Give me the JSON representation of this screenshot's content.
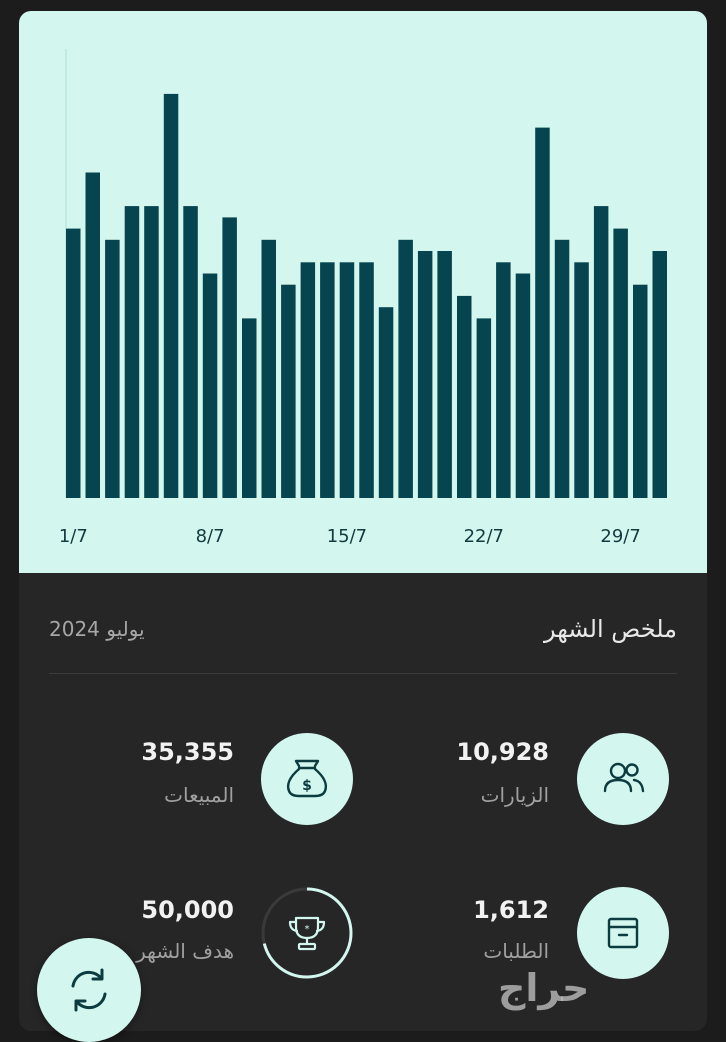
{
  "chart_data": {
    "type": "bar",
    "categories": [
      "1/7",
      "2/7",
      "3/7",
      "4/7",
      "5/7",
      "6/7",
      "7/7",
      "8/7",
      "9/7",
      "10/7",
      "11/7",
      "12/7",
      "13/7",
      "14/7",
      "15/7",
      "16/7",
      "17/7",
      "18/7",
      "19/7",
      "20/7",
      "21/7",
      "22/7",
      "23/7",
      "24/7",
      "25/7",
      "26/7",
      "27/7",
      "28/7",
      "29/7",
      "30/7",
      "31/7"
    ],
    "values": [
      24,
      29,
      23,
      26,
      26,
      36,
      26,
      20,
      25,
      16,
      23,
      19,
      21,
      21,
      21,
      21,
      17,
      23,
      22,
      22,
      18,
      16,
      21,
      20,
      33,
      23,
      21,
      26,
      24,
      19,
      22
    ],
    "x_tick_labels": [
      "1/7",
      "8/7",
      "15/7",
      "22/7",
      "29/7"
    ],
    "ylim": [
      0,
      40
    ],
    "grid": false,
    "bar_color": "#06454f",
    "background": "#d3f7ef"
  },
  "summary": {
    "title": "ملخص الشهر",
    "month": "يوليو 2024"
  },
  "stats": {
    "visits": {
      "value": "10,928",
      "label": "الزيارات",
      "icon": "users-icon"
    },
    "sales": {
      "value": "35,355",
      "label": "المبيعات",
      "icon": "money-bag-icon"
    },
    "orders": {
      "value": "1,612",
      "label": "الطلبات",
      "icon": "box-icon"
    },
    "goal": {
      "value": "50,000",
      "label": "هدف الشهر",
      "icon": "trophy-icon",
      "progress": 0.71
    }
  },
  "fab": {
    "icon": "refresh-icon"
  },
  "watermark": "حراج",
  "colors": {
    "accent": "#d3f7ef",
    "bar": "#06454f",
    "icon_stroke": "#0c3b40",
    "background": "#262626"
  }
}
